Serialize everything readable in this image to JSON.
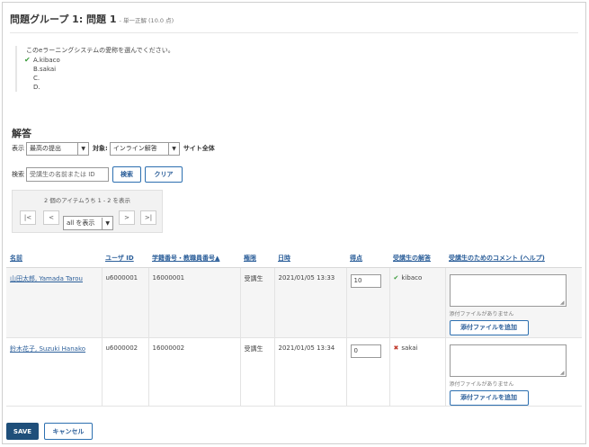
{
  "header": {
    "title": "問題グループ 1: 問題 1",
    "subtitle": "- 単一正解 (10.0 点)"
  },
  "question": {
    "text": "このeラーニングシステムの愛称を選んでください。",
    "answers": [
      "A.kibaco",
      "B.sakai",
      "C.",
      "D."
    ],
    "correct_icon": "check-icon"
  },
  "section_title": "解答",
  "filters": {
    "show_label": "表示",
    "show_value": "最高の提出",
    "target_label": "対象:",
    "target_value": "インライン解答",
    "scope_text": "サイト全体"
  },
  "search": {
    "label": "検索",
    "placeholder": "受講生の名前または ID",
    "search_button": "検索",
    "clear_button": "クリア"
  },
  "pager": {
    "count_text": "2 個のアイテムうち 1 - 2 を表示",
    "first": "|<",
    "prev": "<",
    "next": ">",
    "last": ">|",
    "page_size": "all を表示"
  },
  "table": {
    "headers": {
      "name": "名前",
      "user_id": "ユーザ ID",
      "student_no": "学籍番号・教職員番号▲",
      "role": "権限",
      "datetime": "日時",
      "score": "得点",
      "answer": "受講生の解答",
      "comment": "受講生のためのコメント (ヘルプ)"
    },
    "rows": [
      {
        "name": "山田太郎, Yamada Tarou",
        "user_id": "u6000001",
        "student_no": "16000001",
        "role": "受講生",
        "datetime": "2021/01/05 13:33",
        "score": "10",
        "answer": "kibaco",
        "correct": true,
        "attach_note": "添付ファイルがありません",
        "attach_button": "添付ファイルを追加"
      },
      {
        "name": "鈴木花子, Suzuki Hanako",
        "user_id": "u6000002",
        "student_no": "16000002",
        "role": "受講生",
        "datetime": "2021/01/05 13:34",
        "score": "0",
        "answer": "sakai",
        "correct": false,
        "attach_note": "添付ファイルがありません",
        "attach_button": "添付ファイルを追加"
      }
    ]
  },
  "footer": {
    "save": "SAVE",
    "cancel": "キャンセル"
  },
  "colors": {
    "accent": "#2c5f9a",
    "primary_button": "#1f4f7a",
    "correct": "#3a9a3a",
    "incorrect": "#c0392b"
  }
}
